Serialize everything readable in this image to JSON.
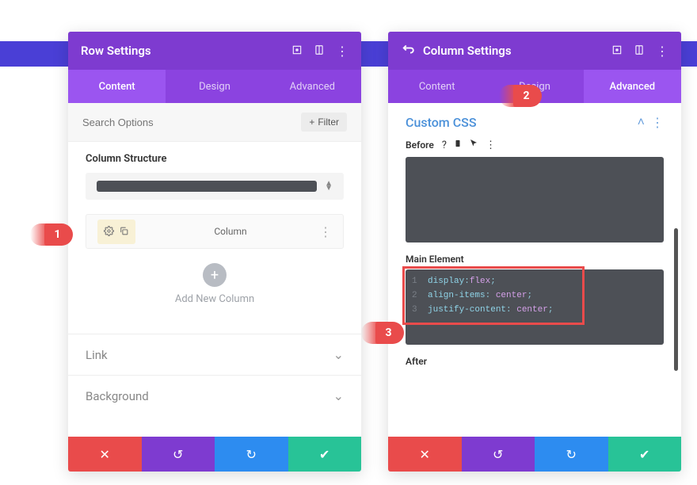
{
  "panels": {
    "left": {
      "title": "Row Settings",
      "tabs": [
        "Content",
        "Design",
        "Advanced"
      ],
      "activeTab": 0,
      "search": {
        "placeholder": "Search Options",
        "filter": "Filter"
      },
      "columnStructure": {
        "label": "Column Structure"
      },
      "columnRow": {
        "label": "Column"
      },
      "addColumn": {
        "label": "Add New Column"
      },
      "accordions": [
        "Link",
        "Background"
      ]
    },
    "right": {
      "title": "Column Settings",
      "tabs": [
        "Content",
        "Design",
        "Advanced"
      ],
      "activeTab": 2,
      "customCss": {
        "title": "Custom CSS",
        "before": {
          "label": "Before"
        },
        "main": {
          "label": "Main Element",
          "code": [
            {
              "n": "1",
              "prop": "display",
              "val": "flex"
            },
            {
              "n": "2",
              "prop": "align-items",
              "val": "center"
            },
            {
              "n": "3",
              "prop": "justify-content",
              "val": "center"
            }
          ]
        },
        "after": {
          "label": "After"
        }
      }
    }
  },
  "badges": {
    "b1": "1",
    "b2": "2",
    "b3": "3"
  }
}
